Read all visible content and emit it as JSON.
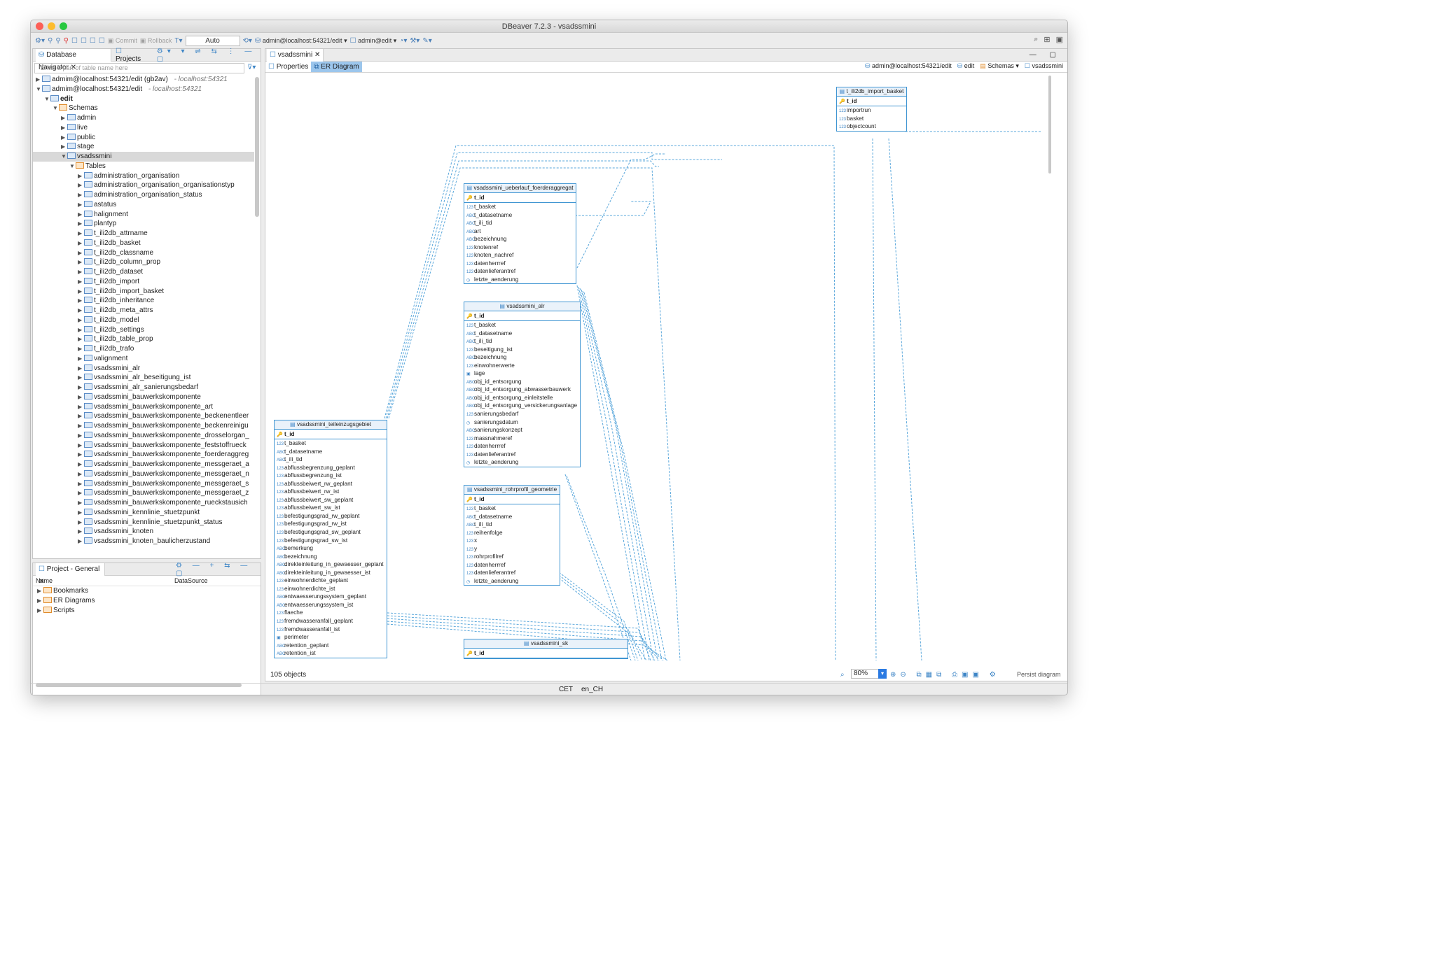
{
  "window": {
    "title": "DBeaver 7.2.3 - vsadssmini"
  },
  "toolbar": {
    "commit": "Commit",
    "rollback": "Rollback",
    "auto": "Auto",
    "connection": "admin@localhost:54321/edit",
    "schema": "admin@edit"
  },
  "navigator": {
    "tab1": "Database Navigator",
    "tab2": "Projects",
    "filter_placeholder": "Enter a part of table name here",
    "connections": [
      {
        "label": "admim@localhost:54321/edit (gb2av)",
        "host": "- localhost:54321"
      },
      {
        "label": "admim@localhost:54321/edit",
        "host": "- localhost:54321"
      }
    ],
    "db": "edit",
    "schemas_label": "Schemas",
    "schemas": [
      "admin",
      "live",
      "public",
      "stage",
      "vsadssmini"
    ],
    "tables_label": "Tables",
    "tables": [
      "administration_organisation",
      "administration_organisation_organisationstyp",
      "administration_organisation_status",
      "astatus",
      "halignment",
      "plantyp",
      "t_ili2db_attrname",
      "t_ili2db_basket",
      "t_ili2db_classname",
      "t_ili2db_column_prop",
      "t_ili2db_dataset",
      "t_ili2db_import",
      "t_ili2db_import_basket",
      "t_ili2db_inheritance",
      "t_ili2db_meta_attrs",
      "t_ili2db_model",
      "t_ili2db_settings",
      "t_ili2db_table_prop",
      "t_ili2db_trafo",
      "valignment",
      "vsadssmini_alr",
      "vsadssmini_alr_beseitigung_ist",
      "vsadssmini_alr_sanierungsbedarf",
      "vsadssmini_bauwerkskomponente",
      "vsadssmini_bauwerkskomponente_art",
      "vsadssmini_bauwerkskomponente_beckenentleer",
      "vsadssmini_bauwerkskomponente_beckenreinigu",
      "vsadssmini_bauwerkskomponente_drosselorgan_",
      "vsadssmini_bauwerkskomponente_feststoffrueck",
      "vsadssmini_bauwerkskomponente_foerderaggreg",
      "vsadssmini_bauwerkskomponente_messgeraet_a",
      "vsadssmini_bauwerkskomponente_messgeraet_n",
      "vsadssmini_bauwerkskomponente_messgeraet_s",
      "vsadssmini_bauwerkskomponente_messgeraet_z",
      "vsadssmini_bauwerkskomponente_rueckstausich",
      "vsadssmini_kennlinie_stuetzpunkt",
      "vsadssmini_kennlinie_stuetzpunkt_status",
      "vsadssmini_knoten",
      "vsadssmini_knoten_baulicherzustand"
    ]
  },
  "project": {
    "title": "Project - General",
    "col_name": "Name",
    "col_ds": "DataSource",
    "items": [
      "Bookmarks",
      "ER Diagrams",
      "Scripts"
    ]
  },
  "editor": {
    "tab": "vsadssmini",
    "subtab_properties": "Properties",
    "subtab_er": "ER Diagram",
    "crumb_conn": "admin@localhost:54321/edit",
    "crumb_db": "edit",
    "crumb_schemas": "Schemas",
    "crumb_schema": "vsadssmini"
  },
  "entities": {
    "import_basket": {
      "title": "t_ili2db_import_basket",
      "pk": "t_id",
      "cols": [
        [
          "123",
          "importrun"
        ],
        [
          "123",
          "basket"
        ],
        [
          "123",
          "objectcount"
        ]
      ]
    },
    "ueberlauf": {
      "title": "vsadssmini_ueberlauf_foerderaggregat",
      "pk": "t_id",
      "cols": [
        [
          "123",
          "t_basket"
        ],
        [
          "abc",
          "t_datasetname"
        ],
        [
          "abc",
          "t_ili_tid"
        ],
        [
          "abc",
          "art"
        ],
        [
          "abc",
          "bezeichnung"
        ],
        [
          "123",
          "knotenref"
        ],
        [
          "123",
          "knoten_nachref"
        ],
        [
          "123",
          "datenherrref"
        ],
        [
          "123",
          "datenlieferantref"
        ],
        [
          "clk",
          "letzte_aenderung"
        ]
      ]
    },
    "alr": {
      "title": "vsadssmini_alr",
      "pk": "t_id",
      "cols": [
        [
          "123",
          "t_basket"
        ],
        [
          "abc",
          "t_datasetname"
        ],
        [
          "abc",
          "t_ili_tid"
        ],
        [
          "123",
          "beseitigung_ist"
        ],
        [
          "abc",
          "bezeichnung"
        ],
        [
          "123",
          "einwohnerwerte"
        ],
        [
          "geo",
          "lage"
        ],
        [
          "abc",
          "obj_id_entsorgung"
        ],
        [
          "abc",
          "obj_id_entsorgung_abwasserbauwerk"
        ],
        [
          "abc",
          "obj_id_entsorgung_einleitstelle"
        ],
        [
          "abc",
          "obj_id_entsorgung_versickerungsanlage"
        ],
        [
          "123",
          "sanierungsbedarf"
        ],
        [
          "clk",
          "sanierungsdatum"
        ],
        [
          "abc",
          "sanierungskonzept"
        ],
        [
          "123",
          "massnahmeref"
        ],
        [
          "123",
          "datenherrref"
        ],
        [
          "123",
          "datenlieferantref"
        ],
        [
          "clk",
          "letzte_aenderung"
        ]
      ]
    },
    "rohrprofil": {
      "title": "vsadssmini_rohrprofil_geometrie",
      "pk": "t_id",
      "cols": [
        [
          "123",
          "t_basket"
        ],
        [
          "abc",
          "t_datasetname"
        ],
        [
          "abc",
          "t_ili_tid"
        ],
        [
          "123",
          "reihenfolge"
        ],
        [
          "123",
          "x"
        ],
        [
          "123",
          "y"
        ],
        [
          "123",
          "rohrprofilref"
        ],
        [
          "123",
          "datenherrref"
        ],
        [
          "123",
          "datenlieferantref"
        ],
        [
          "clk",
          "letzte_aenderung"
        ]
      ]
    },
    "teileinzugsgebiet": {
      "title": "vsadssmini_teileinzugsgebiet",
      "pk": "t_id",
      "cols": [
        [
          "123",
          "t_basket"
        ],
        [
          "abc",
          "t_datasetname"
        ],
        [
          "abc",
          "t_ili_tid"
        ],
        [
          "123",
          "abflussbegrenzung_geplant"
        ],
        [
          "123",
          "abflussbegrenzung_ist"
        ],
        [
          "123",
          "abflussbeiwert_rw_geplant"
        ],
        [
          "123",
          "abflussbeiwert_rw_ist"
        ],
        [
          "123",
          "abflussbeiwert_sw_geplant"
        ],
        [
          "123",
          "abflussbeiwert_sw_ist"
        ],
        [
          "123",
          "befestigungsgrad_rw_geplant"
        ],
        [
          "123",
          "befestigungsgrad_rw_ist"
        ],
        [
          "123",
          "befestigungsgrad_sw_geplant"
        ],
        [
          "123",
          "befestigungsgrad_sw_ist"
        ],
        [
          "abc",
          "bemerkung"
        ],
        [
          "abc",
          "bezeichnung"
        ],
        [
          "abc",
          "direkteinleitung_in_gewaesser_geplant"
        ],
        [
          "abc",
          "direkteinleitung_in_gewaesser_ist"
        ],
        [
          "123",
          "einwohnerdichte_geplant"
        ],
        [
          "123",
          "einwohnerdichte_ist"
        ],
        [
          "abc",
          "entwaesserungssystem_geplant"
        ],
        [
          "abc",
          "entwaesserungssystem_ist"
        ],
        [
          "123",
          "flaeche"
        ],
        [
          "123",
          "fremdwasseranfall_geplant"
        ],
        [
          "123",
          "fremdwasseranfall_ist"
        ],
        [
          "geo",
          "perimeter"
        ],
        [
          "abc",
          "retention_geplant"
        ],
        [
          "abc",
          "retention_ist"
        ]
      ]
    },
    "sk": {
      "title": "vsadssmini_sk",
      "pk": "t_id",
      "cols": []
    }
  },
  "status": {
    "objects": "105 objects",
    "zoom": "80%",
    "persist": "Persist diagram"
  },
  "footer": {
    "tz": "CET",
    "locale": "en_CH"
  }
}
